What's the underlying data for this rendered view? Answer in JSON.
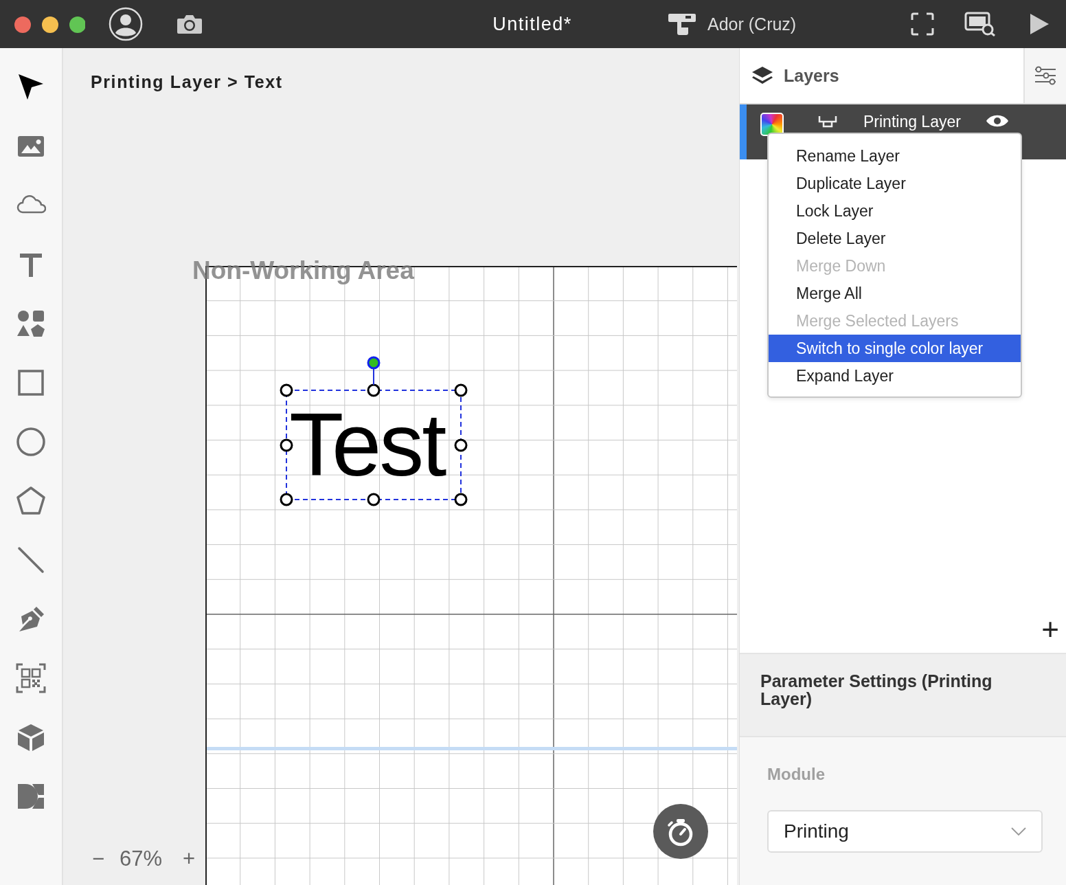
{
  "window": {
    "title": "Untitled*"
  },
  "top_bar": {
    "device": "Ador (Cruz)"
  },
  "tools": [
    {
      "kind": "select",
      "selected": true
    },
    {
      "kind": "image",
      "selected": false
    },
    {
      "kind": "cloud",
      "selected": false
    },
    {
      "kind": "text",
      "selected": false
    },
    {
      "kind": "shapes",
      "selected": false
    },
    {
      "kind": "rectangle",
      "selected": false
    },
    {
      "kind": "ellipse",
      "selected": false
    },
    {
      "kind": "polygon",
      "selected": false
    },
    {
      "kind": "line",
      "selected": false
    },
    {
      "kind": "pen",
      "selected": false
    },
    {
      "kind": "qr",
      "selected": false
    },
    {
      "kind": "box",
      "selected": false
    },
    {
      "kind": "dmkit",
      "selected": false
    }
  ],
  "breadcrumb": "Printing Layer > Text",
  "canvas": {
    "area_label": "Non-Working Area",
    "objects": [
      {
        "kind": "text",
        "text": "Test",
        "selected": true
      }
    ]
  },
  "zoom": {
    "minus": "−",
    "level": "67%",
    "plus": "+"
  },
  "layers_panel": {
    "title": "Layers",
    "layers": [
      {
        "name": "Printing Layer",
        "selected": true,
        "visible": true
      }
    ],
    "add": "+"
  },
  "menu": {
    "items": [
      {
        "label": "Rename Layer",
        "disabled": false,
        "selected": false
      },
      {
        "label": "Duplicate Layer",
        "disabled": false,
        "selected": false
      },
      {
        "label": "Lock Layer",
        "disabled": false,
        "selected": false
      },
      {
        "label": "Delete Layer",
        "disabled": false,
        "selected": false
      },
      {
        "label": "Merge Down",
        "disabled": true,
        "selected": false
      },
      {
        "label": "Merge All",
        "disabled": false,
        "selected": false
      },
      {
        "label": "Merge Selected Layers",
        "disabled": true,
        "selected": false
      },
      {
        "label": "Switch to single color layer",
        "disabled": false,
        "selected": true
      },
      {
        "label": "Expand Layer",
        "disabled": false,
        "selected": false
      }
    ]
  },
  "parameters": {
    "title": "Parameter Settings (Printing Layer)",
    "module_label": "Module",
    "module_value": "Printing"
  }
}
